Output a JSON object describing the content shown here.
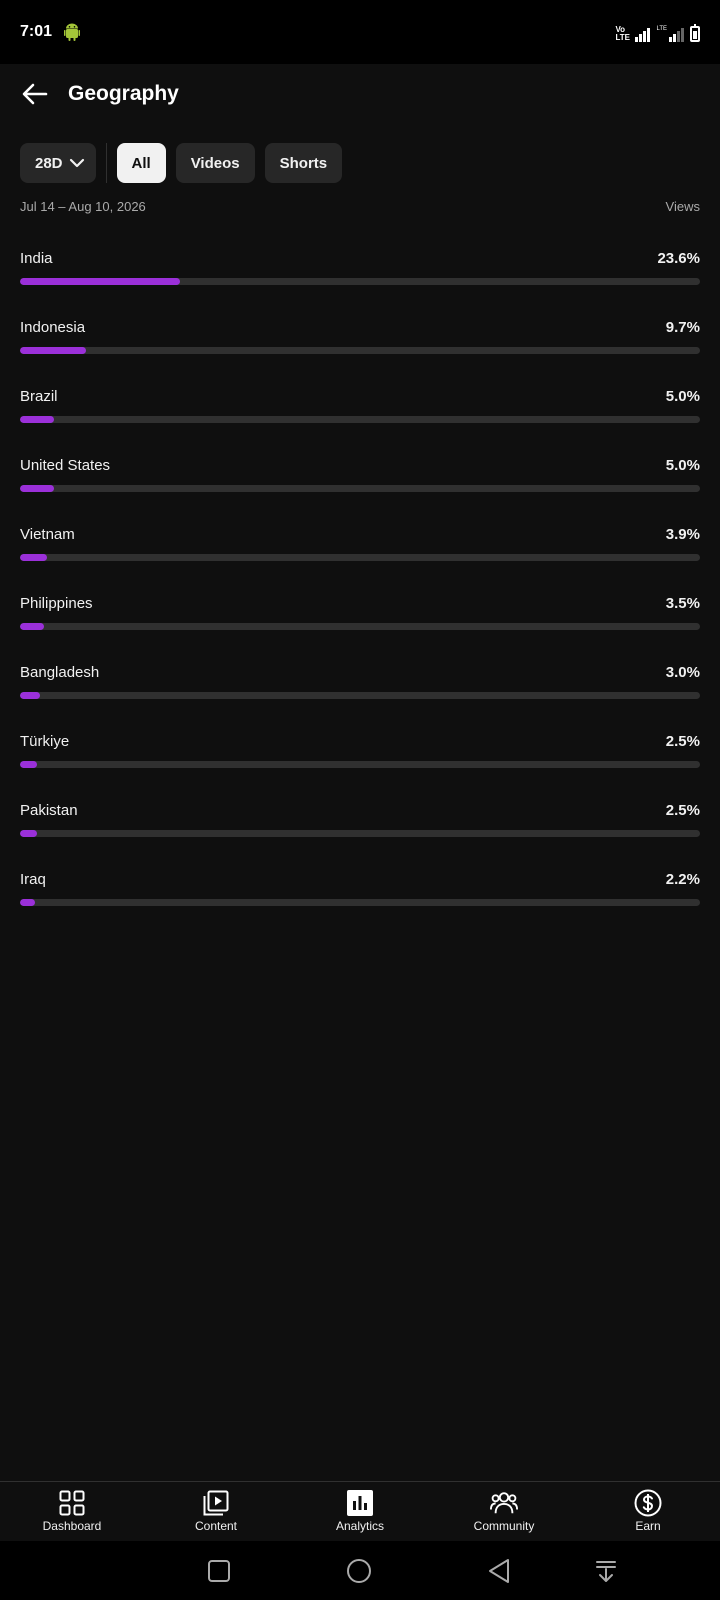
{
  "status_bar": {
    "time": "7:01",
    "volte_label": "Vo LTE",
    "lte_label": "LTE"
  },
  "header": {
    "title": "Geography"
  },
  "filters": {
    "period": "28D",
    "chips": [
      {
        "label": "All",
        "selected": true
      },
      {
        "label": "Videos",
        "selected": false
      },
      {
        "label": "Shorts",
        "selected": false
      }
    ]
  },
  "date_range": "Jul 14 – Aug 10, 2026",
  "metric_label": "Views",
  "accent_color": "#9b30d9",
  "geo_rows": [
    {
      "country": "India",
      "value_label": "23.6%",
      "value": 23.6
    },
    {
      "country": "Indonesia",
      "value_label": "9.7%",
      "value": 9.7
    },
    {
      "country": "Brazil",
      "value_label": "5.0%",
      "value": 5.0
    },
    {
      "country": "United States",
      "value_label": "5.0%",
      "value": 5.0
    },
    {
      "country": "Vietnam",
      "value_label": "3.9%",
      "value": 3.9
    },
    {
      "country": "Philippines",
      "value_label": "3.5%",
      "value": 3.5
    },
    {
      "country": "Bangladesh",
      "value_label": "3.0%",
      "value": 3.0
    },
    {
      "country": "Türkiye",
      "value_label": "2.5%",
      "value": 2.5
    },
    {
      "country": "Pakistan",
      "value_label": "2.5%",
      "value": 2.5
    },
    {
      "country": "Iraq",
      "value_label": "2.2%",
      "value": 2.2
    }
  ],
  "bottom_nav": [
    {
      "label": "Dashboard",
      "icon": "dashboard-icon"
    },
    {
      "label": "Content",
      "icon": "content-icon"
    },
    {
      "label": "Analytics",
      "icon": "analytics-icon"
    },
    {
      "label": "Community",
      "icon": "community-icon"
    },
    {
      "label": "Earn",
      "icon": "earn-icon"
    }
  ]
}
